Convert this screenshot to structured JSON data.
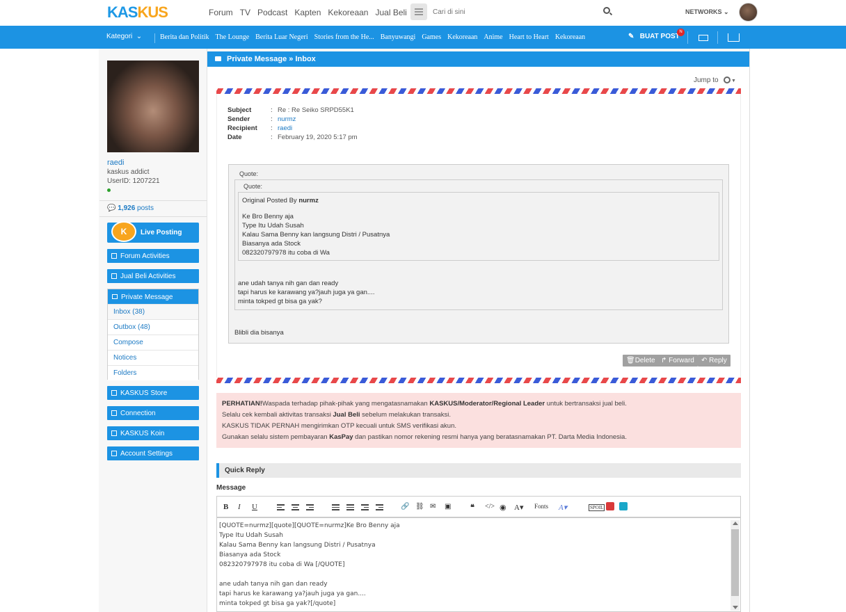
{
  "header": {
    "logo_part1": "KAS",
    "logo_part2": "KUS",
    "nav": [
      "Forum",
      "TV",
      "Podcast",
      "Kapten",
      "Kekoreaan",
      "Jual Beli"
    ],
    "search_placeholder": "Cari di sini",
    "networks": "NETWORKS"
  },
  "catbar": {
    "kategori": "Kategori",
    "items": [
      "Berita dan Politik",
      "The Lounge",
      "Berita Luar Negeri",
      "Stories from the He...",
      "Banyuwangi",
      "Games",
      "Kekoreaan",
      "Anime",
      "Heart to Heart",
      "Kekoreaan"
    ],
    "buat_post": "BUAT POST",
    "badge": "N"
  },
  "sidebar": {
    "username": "raedi",
    "rank": "kaskus addict",
    "userid": "UserID: 1207221",
    "posts_count": "1,926",
    "posts_label": " posts",
    "live_posting": "Live Posting",
    "forum_activities": "Forum Activities",
    "jual_beli_activities": "Jual Beli Activities",
    "private_message": "Private Message",
    "pm_items": [
      "Inbox (38)",
      "Outbox (48)",
      "Compose",
      "Notices",
      "Folders"
    ],
    "kaskus_store": "KASKUS Store",
    "connection": "Connection",
    "kaskus_koin": "KASKUS Koin",
    "account_settings": "Account Settings"
  },
  "main": {
    "title": "Private Message » Inbox",
    "jump_to": "Jump to",
    "meta": {
      "subject_label": "Subject",
      "subject": "Re : Re Seiko SRPD55K1",
      "sender_label": "Sender",
      "sender": "nurmz",
      "recipient_label": "Recipient",
      "recipient": "raedi",
      "date_label": "Date",
      "date": "February 19, 2020 5:17 pm"
    },
    "quote_label": "Quote:",
    "original_posted_by": "Original Posted By ",
    "original_author": "nurmz",
    "inner_lines": [
      "Ke Bro Benny aja",
      "Type Itu Udah Susah",
      "Kalau Sama Benny kan langsung Distri / Pusatnya",
      "Biasanya ada Stock",
      "082320797978 itu coba di Wa"
    ],
    "mid_lines": [
      "ane udah tanya nih gan dan ready",
      "tapi harus ke karawang ya?jauh juga ya gan....",
      "minta tokped gt bisa ga yak?"
    ],
    "reply_text": "Blibli dia bisanya",
    "delete": "Delete",
    "forward": "Forward",
    "reply": "Reply"
  },
  "warning": {
    "l1_b1": "PERHATIAN!",
    "l1_t1": "Waspada terhadap pihak-pihak yang mengatasnamakan ",
    "l1_b2": "KASKUS/Moderator/Regional Leader",
    "l1_t2": " untuk bertransaksi jual beli.",
    "l2_t1": "Selalu cek kembali aktivitas transaksi ",
    "l2_b1": "Jual Beli",
    "l2_t2": " sebelum melakukan transaksi.",
    "l3": "KASKUS TIDAK PERNAH mengirimkan OTP kecuali untuk SMS verifikasi akun.",
    "l4_t1": "Gunakan selalu sistem pembayaran ",
    "l4_b1": "KasPay",
    "l4_t2": " dan pastikan nomor rekening resmi hanya yang beratasnamakan PT. Darta Media Indonesia."
  },
  "quick_reply": {
    "title": "Quick Reply",
    "message_label": "Message",
    "toolbar_fonts": "Fonts",
    "editor_text": "[QUOTE=nurmz][quote][QUOTE=nurmz]Ke Bro Benny aja\nType Itu Udah Susah\nKalau Sama Benny kan langsung Distri / Pusatnya\nBiasanya ada Stock\n082320797978 itu coba di Wa [/QUOTE]\n\nane udah tanya nih gan dan ready\ntapi harus ke karawang ya?jauh juga ya gan....\nminta tokped gt bisa ga yak?[/quote]"
  },
  "colors": {
    "brand_blue": "#1c93e3",
    "brand_orange": "#f8a51d",
    "warning_bg": "#fbe0df"
  }
}
